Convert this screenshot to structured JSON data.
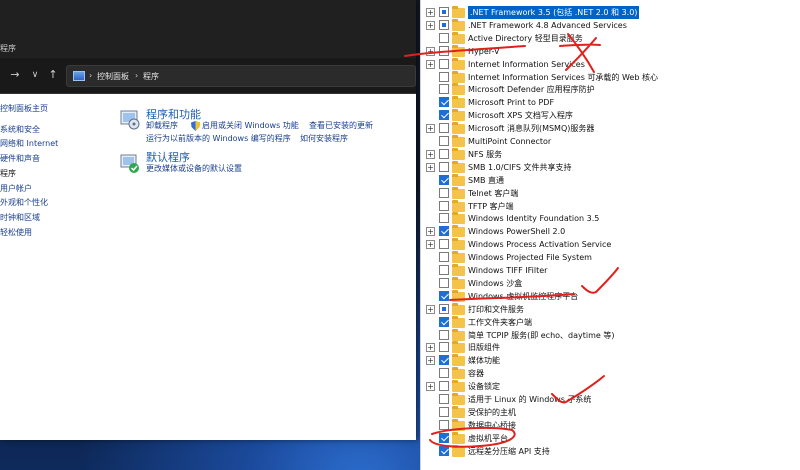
{
  "control_panel": {
    "title_fragment": "程序",
    "nav": {
      "forward": "→",
      "down": "∨",
      "up": "↑"
    },
    "breadcrumb": [
      "控制面板",
      "程序"
    ],
    "sidebar": [
      {
        "label": "控制面板主页",
        "current": false
      },
      {
        "label": "系统和安全",
        "current": false
      },
      {
        "label": "网络和 Internet",
        "current": false
      },
      {
        "label": "硬件和声音",
        "current": false
      },
      {
        "label": "程序",
        "current": true
      },
      {
        "label": "用户帐户",
        "current": false
      },
      {
        "label": "外观和个性化",
        "current": false
      },
      {
        "label": "时钟和区域",
        "current": false
      },
      {
        "label": "轻松使用",
        "current": false
      }
    ],
    "sections": [
      {
        "title": "程序和功能",
        "links": [
          "卸载程序",
          "启用或关闭 Windows 功能",
          "查看已安装的更新",
          "运行为以前版本的 Windows 编写的程序",
          "如何安装程序"
        ]
      },
      {
        "title": "默认程序",
        "links": [
          "更改媒体或设备的默认设置"
        ]
      }
    ]
  },
  "features": [
    {
      "label": ".NET Framework 3.5 (包括 .NET 2.0 和 3.0)",
      "expander": "+",
      "state": "partial",
      "selected": true
    },
    {
      "label": ".NET Framework 4.8 Advanced Services",
      "expander": "+",
      "state": "partial",
      "selected": false
    },
    {
      "label": "Active Directory 轻型目录服务",
      "expander": "",
      "state": "unchecked",
      "selected": false
    },
    {
      "label": "Hyper-V",
      "expander": "+",
      "state": "unchecked",
      "selected": false
    },
    {
      "label": "Internet Information Services",
      "expander": "+",
      "state": "unchecked",
      "selected": false
    },
    {
      "label": "Internet Information Services 可承载的 Web 核心",
      "expander": "",
      "state": "unchecked",
      "selected": false
    },
    {
      "label": "Microsoft Defender 应用程序防护",
      "expander": "",
      "state": "unchecked",
      "selected": false
    },
    {
      "label": "Microsoft Print to PDF",
      "expander": "",
      "state": "checked",
      "selected": false
    },
    {
      "label": "Microsoft XPS 文档写入程序",
      "expander": "",
      "state": "checked",
      "selected": false
    },
    {
      "label": "Microsoft 消息队列(MSMQ)服务器",
      "expander": "+",
      "state": "unchecked",
      "selected": false
    },
    {
      "label": "MultiPoint Connector",
      "expander": "",
      "state": "unchecked",
      "selected": false
    },
    {
      "label": "NFS 服务",
      "expander": "+",
      "state": "unchecked",
      "selected": false
    },
    {
      "label": "SMB 1.0/CIFS 文件共享支持",
      "expander": "+",
      "state": "unchecked",
      "selected": false
    },
    {
      "label": "SMB 直通",
      "expander": "",
      "state": "checked",
      "selected": false
    },
    {
      "label": "Telnet 客户端",
      "expander": "",
      "state": "unchecked",
      "selected": false
    },
    {
      "label": "TFTP 客户端",
      "expander": "",
      "state": "unchecked",
      "selected": false
    },
    {
      "label": "Windows Identity Foundation 3.5",
      "expander": "",
      "state": "unchecked",
      "selected": false
    },
    {
      "label": "Windows PowerShell 2.0",
      "expander": "+",
      "state": "checked",
      "selected": false
    },
    {
      "label": "Windows Process Activation Service",
      "expander": "+",
      "state": "unchecked",
      "selected": false
    },
    {
      "label": "Windows Projected File System",
      "expander": "",
      "state": "unchecked",
      "selected": false
    },
    {
      "label": "Windows TIFF IFilter",
      "expander": "",
      "state": "unchecked",
      "selected": false
    },
    {
      "label": "Windows 沙盒",
      "expander": "",
      "state": "unchecked",
      "selected": false
    },
    {
      "label": "Windows 虚拟机监控程序平台",
      "expander": "",
      "state": "checked",
      "selected": false
    },
    {
      "label": "打印和文件服务",
      "expander": "+",
      "state": "partial",
      "selected": false
    },
    {
      "label": "工作文件夹客户端",
      "expander": "",
      "state": "checked",
      "selected": false
    },
    {
      "label": "简单 TCPIP 服务(即 echo、daytime 等)",
      "expander": "",
      "state": "unchecked",
      "selected": false
    },
    {
      "label": "旧版组件",
      "expander": "+",
      "state": "unchecked",
      "selected": false
    },
    {
      "label": "媒体功能",
      "expander": "+",
      "state": "checked",
      "selected": false
    },
    {
      "label": "容器",
      "expander": "",
      "state": "unchecked",
      "selected": false
    },
    {
      "label": "设备锁定",
      "expander": "+",
      "state": "unchecked",
      "selected": false
    },
    {
      "label": "适用于 Linux 的 Windows 子系统",
      "expander": "",
      "state": "unchecked",
      "selected": false
    },
    {
      "label": "受保护的主机",
      "expander": "",
      "state": "unchecked",
      "selected": false
    },
    {
      "label": "数据中心桥接",
      "expander": "",
      "state": "unchecked",
      "selected": false
    },
    {
      "label": "虚拟机平台",
      "expander": "",
      "state": "checked",
      "selected": false
    },
    {
      "label": "远程差分压缩 API 支持",
      "expander": "",
      "state": "checked",
      "selected": false
    }
  ],
  "colors": {
    "annotation_red": "#e0201c",
    "link_blue": "#1a3f8f",
    "title_blue": "#1c5fb5",
    "selection_blue": "#0063c8"
  }
}
